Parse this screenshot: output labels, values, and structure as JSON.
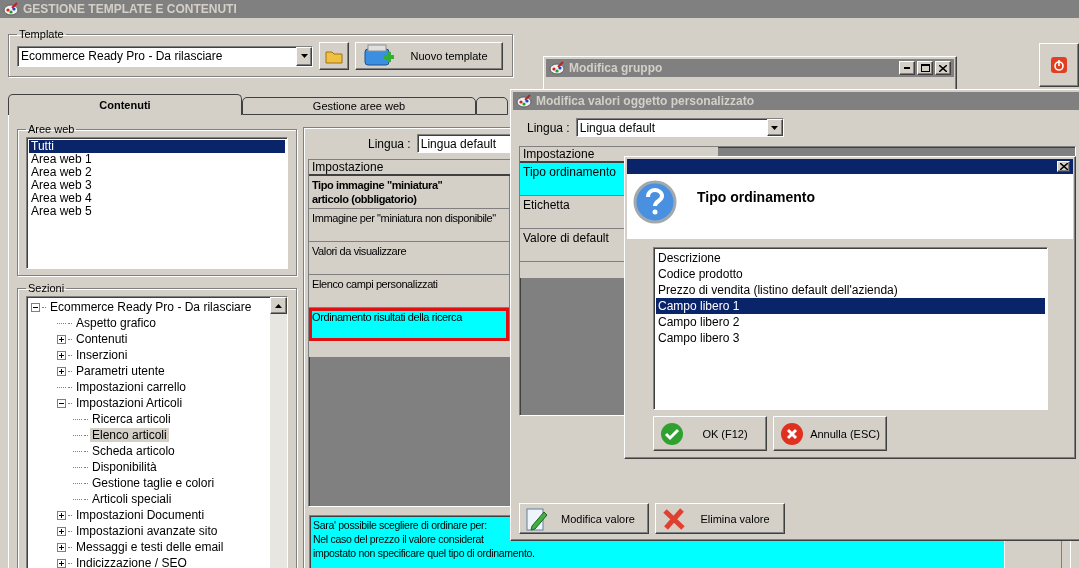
{
  "window": {
    "title": "GESTIONE TEMPLATE E CONTENUTI"
  },
  "template": {
    "label": "Template",
    "value": "Ecommerce Ready Pro - Da rilasciare",
    "new_button": "Nuovo template"
  },
  "tabs": [
    {
      "label": "Contenuti",
      "selected": true
    },
    {
      "label": "Gestione aree web",
      "selected": false
    },
    {
      "selected": false
    }
  ],
  "web_areas": {
    "label": "Aree web",
    "items": [
      {
        "label": "Tutti",
        "selected": true
      },
      {
        "label": "Area web 1",
        "selected": false
      },
      {
        "label": "Area web 2",
        "selected": false
      },
      {
        "label": "Area web 3",
        "selected": false
      },
      {
        "label": "Area web 4",
        "selected": false
      },
      {
        "label": "Area web 5",
        "selected": false
      }
    ]
  },
  "sections": {
    "label": "Sezioni",
    "tree": [
      {
        "label": "Ecommerce Ready Pro - Da rilasciare",
        "expanded": true,
        "selected": false,
        "children": [
          {
            "label": "Aspetto grafico",
            "selected": false
          },
          {
            "label": "Contenuti",
            "expanded": false,
            "selected": false
          },
          {
            "label": "Inserzioni",
            "expanded": false,
            "selected": false
          },
          {
            "label": "Parametri utente",
            "expanded": false,
            "selected": false
          },
          {
            "label": "Impostazioni carrello",
            "selected": false
          },
          {
            "label": "Impostazioni Articoli",
            "expanded": true,
            "selected": false,
            "children": [
              {
                "label": "Ricerca articoli",
                "selected": false
              },
              {
                "label": "Elenco articoli",
                "selected": true
              },
              {
                "label": "Scheda articolo",
                "selected": false
              },
              {
                "label": "Disponibilità",
                "selected": false
              },
              {
                "label": "Gestione taglie e colori",
                "selected": false
              },
              {
                "label": "Articoli speciali",
                "selected": false
              }
            ]
          },
          {
            "label": "Impostazioni Documenti",
            "expanded": false,
            "selected": false
          },
          {
            "label": "Impostazioni avanzate sito",
            "expanded": false,
            "selected": false
          },
          {
            "label": "Messaggi e testi delle email",
            "expanded": false,
            "selected": false
          },
          {
            "label": "Indicizzazione / SEO",
            "expanded": false,
            "selected": false
          }
        ]
      }
    ]
  },
  "settings": {
    "language_label": "Lingua :",
    "language": "Lingua default",
    "column": "Impostazione",
    "rows": [
      {
        "label": "Tipo immagine \"miniatura\" articolo (obbligatorio)",
        "bold": true,
        "selected": false,
        "marked": false
      },
      {
        "label": "Immagine per \"miniatura non disponibile\"",
        "bold": false,
        "selected": false,
        "marked": false
      },
      {
        "label": "Valori da visualizzare",
        "bold": false,
        "selected": false,
        "marked": false
      },
      {
        "label": "Elenco campi personalizzati",
        "bold": false,
        "selected": false,
        "marked": false
      },
      {
        "label": "Ordinamento risultati della ricerca",
        "bold": false,
        "selected": true,
        "marked": true
      }
    ],
    "help": [
      "Sara' possibile scegliere di ordinare per:",
      "Nel caso del prezzo il valore considerat",
      "impostato non specificare quel tipo di ordinamento."
    ]
  },
  "group_window": {
    "title": "Modifica gruppo"
  },
  "values_window": {
    "title": "Modifica valori oggetto personalizzato",
    "language_label": "Lingua :",
    "language": "Lingua default",
    "column": "Impostazione",
    "rows": [
      {
        "label": "Tipo ordinamento",
        "selected": true
      },
      {
        "label": "Etichetta",
        "selected": false
      },
      {
        "label": "Valore di default",
        "selected": false
      }
    ],
    "buttons": [
      {
        "label": "Modifica valore",
        "kind": "edit"
      },
      {
        "label": "Elimina valore",
        "kind": "delete"
      }
    ]
  },
  "dialog": {
    "title": "Tipo ordinamento",
    "options": [
      {
        "label": "Descrizione",
        "selected": false
      },
      {
        "label": "Codice prodotto",
        "selected": false
      },
      {
        "label": "Prezzo di vendita (listino default dell'azienda)",
        "selected": false
      },
      {
        "label": "Campo libero 1",
        "selected": true
      },
      {
        "label": "Campo libero 2",
        "selected": false
      },
      {
        "label": "Campo libero 3",
        "selected": false
      }
    ],
    "buttons": [
      {
        "label": "OK (F12)",
        "kind": "ok"
      },
      {
        "label": "Annulla (ESC)",
        "kind": "cancel"
      }
    ]
  }
}
